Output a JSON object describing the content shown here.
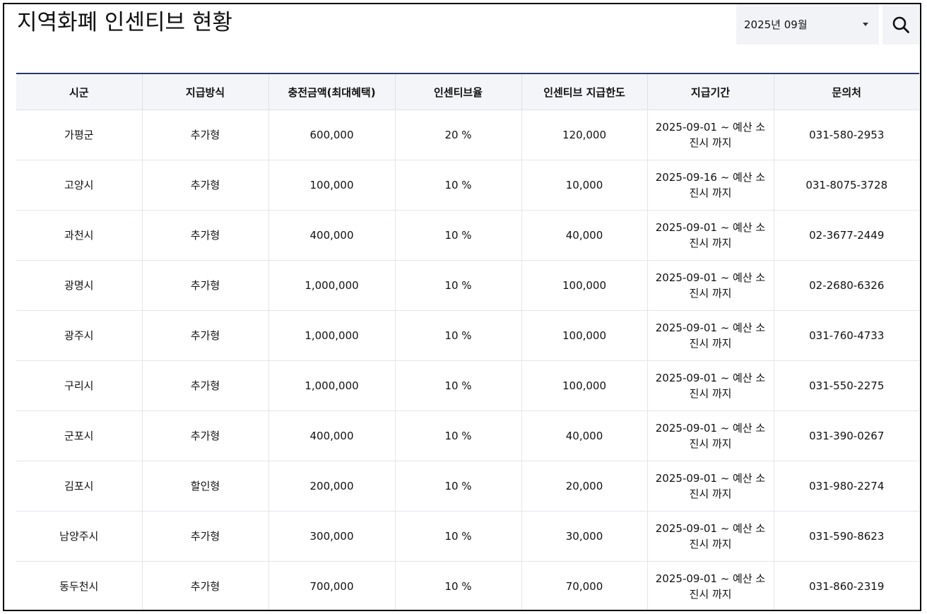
{
  "title": "지역화폐 인센티브 현황",
  "month_select": {
    "value": "2025년 09월"
  },
  "table": {
    "headers": [
      "시군",
      "지급방식",
      "충전금액(최대혜택)",
      "인센티브율",
      "인센티브 지급한도",
      "지급기간",
      "문의처"
    ],
    "rows": [
      [
        "가평군",
        "추가형",
        "600,000",
        "20 %",
        "120,000",
        "2025-09-01 ~ 예산 소진시 까지",
        "031-580-2953"
      ],
      [
        "고양시",
        "추가형",
        "100,000",
        "10 %",
        "10,000",
        "2025-09-16 ~ 예산 소진시 까지",
        "031-8075-3728"
      ],
      [
        "과천시",
        "추가형",
        "400,000",
        "10 %",
        "40,000",
        "2025-09-01 ~ 예산 소진시 까지",
        "02-3677-2449"
      ],
      [
        "광명시",
        "추가형",
        "1,000,000",
        "10 %",
        "100,000",
        "2025-09-01 ~ 예산 소진시 까지",
        "02-2680-6326"
      ],
      [
        "광주시",
        "추가형",
        "1,000,000",
        "10 %",
        "100,000",
        "2025-09-01 ~ 예산 소진시 까지",
        "031-760-4733"
      ],
      [
        "구리시",
        "추가형",
        "1,000,000",
        "10 %",
        "100,000",
        "2025-09-01 ~ 예산 소진시 까지",
        "031-550-2275"
      ],
      [
        "군포시",
        "추가형",
        "400,000",
        "10 %",
        "40,000",
        "2025-09-01 ~ 예산 소진시 까지",
        "031-390-0267"
      ],
      [
        "김포시",
        "할인형",
        "200,000",
        "10 %",
        "20,000",
        "2025-09-01 ~ 예산 소진시 까지",
        "031-980-2274"
      ],
      [
        "남양주시",
        "추가형",
        "300,000",
        "10 %",
        "30,000",
        "2025-09-01 ~ 예산 소진시 까지",
        "031-590-8623"
      ],
      [
        "동두천시",
        "추가형",
        "700,000",
        "10 %",
        "70,000",
        "2025-09-01 ~ 예산 소진시 까지",
        "031-860-2319"
      ]
    ]
  },
  "icons": {
    "search": "search-icon",
    "dropdown": "chevron-down-icon"
  },
  "colors": {
    "header_rule": "#2b3a67",
    "header_bg": "#f4f5f9",
    "control_bg": "#f1f3f7"
  }
}
